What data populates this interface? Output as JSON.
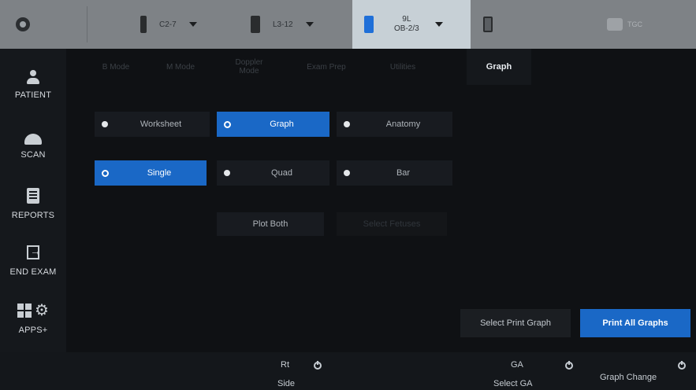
{
  "probes": [
    {
      "label": "C2-7"
    },
    {
      "label": "L3-12"
    },
    {
      "label_line1": "9L",
      "label_line2": "OB-2/3",
      "active": true
    },
    {
      "label": ""
    }
  ],
  "tgc_label": "TGC",
  "sidebar": {
    "items": [
      {
        "label": "PATIENT",
        "icon": "person-icon"
      },
      {
        "label": "SCAN",
        "icon": "scan-icon"
      },
      {
        "label": "REPORTS",
        "icon": "reports-icon"
      },
      {
        "label": "END EXAM",
        "icon": "exit-icon"
      },
      {
        "label": "APPS+",
        "icon": "apps-icon"
      }
    ]
  },
  "tabs": [
    {
      "label": "B Mode"
    },
    {
      "label": "M Mode"
    },
    {
      "label_line1": "Doppler",
      "label_line2": "Mode"
    },
    {
      "label": "Exam Prep"
    },
    {
      "label": "Utilities"
    },
    {
      "label": "Graph",
      "active": true
    }
  ],
  "options": {
    "row1": [
      "Worksheet",
      "Graph",
      "Anatomy"
    ],
    "row2": [
      "Single",
      "Quad",
      "Bar"
    ],
    "plot_both": "Plot Both",
    "disabled_option": "Select Fetuses"
  },
  "selected": {
    "row1": "Graph",
    "row2": "Single"
  },
  "actions": {
    "select_print_graph": "Select Print Graph",
    "print_all_graphs": "Print All Graphs"
  },
  "bottom": {
    "knob1_top": "Rt",
    "knob1_bottom": "Side",
    "knob2_top": "GA",
    "knob2_bottom": "Select GA",
    "knob3": "Graph Change"
  },
  "colors": {
    "accent": "#1a68c6",
    "active_probe": "#c7d0d6",
    "topbar": "#7e8286"
  }
}
